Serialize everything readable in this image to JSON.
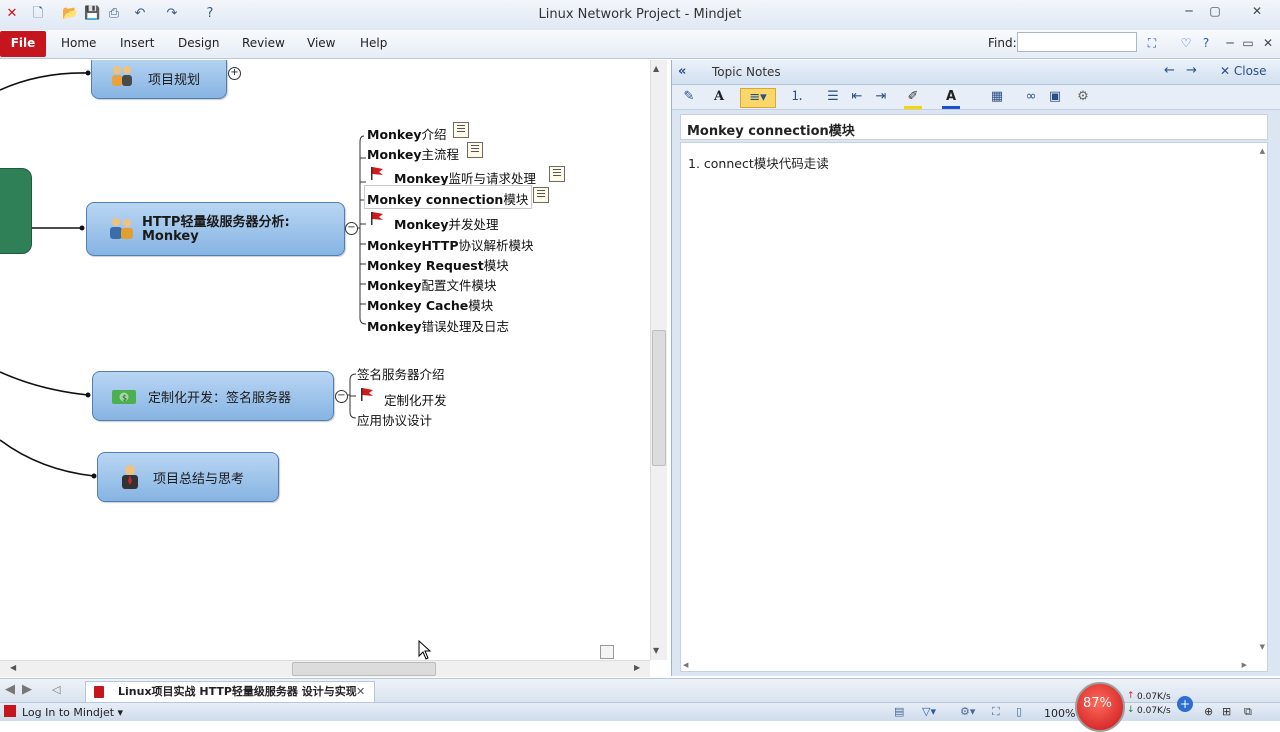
{
  "window": {
    "title": "Linux Network Project - Mindjet"
  },
  "ribbon": {
    "file": "File",
    "tabs": [
      "Home",
      "Insert",
      "Design",
      "Review",
      "View",
      "Help"
    ],
    "find_label": "Find:",
    "find_value": ""
  },
  "map": {
    "topics": [
      {
        "label": "项目规划"
      },
      {
        "label_line1": "HTTP轻量级服务器分析:",
        "label_line2": "Monkey"
      },
      {
        "label": "定制化开发：签名服务器"
      },
      {
        "label": "项目总结与思考"
      }
    ],
    "http_subtopics": [
      {
        "bold": "Monkey",
        "rest": "介绍"
      },
      {
        "bold": "Monkey",
        "rest": "主流程"
      },
      {
        "bold": "Monkey",
        "rest": "监听与请求处理"
      },
      {
        "bold": "Monkey connection",
        "rest": "模块"
      },
      {
        "bold": "Monkey",
        "rest": "并发处理"
      },
      {
        "bold": "MonkeyHTTP",
        "rest": "协议解析模块"
      },
      {
        "bold": "Monkey Request",
        "rest": "模块"
      },
      {
        "bold": "Monkey",
        "rest": "配置文件模块"
      },
      {
        "bold": "Monkey Cache",
        "rest": "模块"
      },
      {
        "bold": "Monkey",
        "rest": "错误处理及日志"
      }
    ],
    "sign_subtopics": [
      "签名服务器介绍",
      "定制化开发",
      "应用协议设计"
    ]
  },
  "notes": {
    "header": "Topic Notes",
    "close": "Close",
    "title": "Monkey connection模块",
    "body": "1. connect模块代码走读"
  },
  "doc_tab": {
    "label": "Linux项目实战 HTTP轻量级服务器 设计与实现"
  },
  "status": {
    "login": "Log In to Mindjet",
    "zoom": "100%",
    "net_percent": "87%",
    "up": "0.07K/s",
    "down": "0.07K/s"
  },
  "colors": {
    "file_tab": "#c4161c",
    "topic_fill": "#9dc3ea",
    "central_topic": "#2f7f57",
    "flag": "#d11a1a"
  }
}
